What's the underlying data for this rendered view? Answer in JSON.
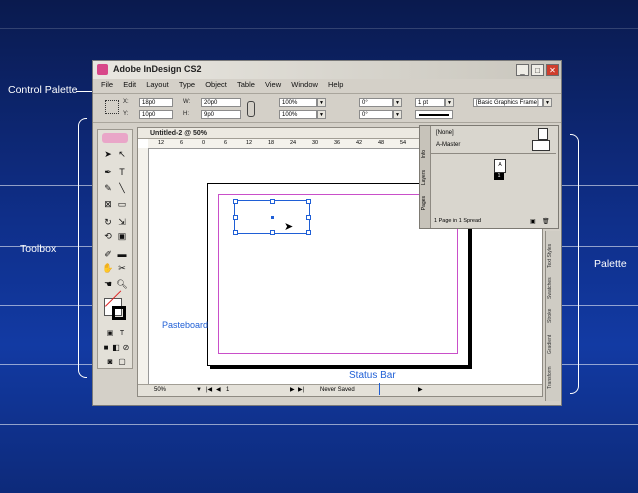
{
  "window": {
    "title": "Adobe InDesign CS2",
    "controls": {
      "minimize": "_",
      "maximize": "□",
      "close": "✕"
    }
  },
  "menu": [
    "File",
    "Edit",
    "Layout",
    "Type",
    "Object",
    "Table",
    "View",
    "Window",
    "Help"
  ],
  "control_palette": {
    "x_label": "X:",
    "x_value": "18p0",
    "y_label": "Y:",
    "y_value": "10p0",
    "w_label": "W:",
    "w_value": "20p0",
    "h_label": "H:",
    "h_value": "9p0",
    "scale_x": "100%",
    "scale_y": "100%",
    "rotate": "0°",
    "shear": "0°",
    "stroke_weight": "1 pt",
    "object_style": "[Basic Graphics Frame]"
  },
  "document": {
    "tab_title": "Untitled-2 @ 50%",
    "ruler_ticks": [
      "12",
      "6",
      "0",
      "6",
      "12",
      "18",
      "24",
      "30",
      "36",
      "42",
      "48",
      "54"
    ],
    "pasteboard_label": "Pasteboard"
  },
  "status_bar": {
    "zoom": "50%",
    "page": "1",
    "save_status": "Never Saved"
  },
  "pages_palette": {
    "tabs": [
      "Pages",
      "Layers",
      "Info"
    ],
    "none_label": "[None]",
    "master_label": "A-Master",
    "page_number": "1",
    "footer": "1 Page in 1 Spread"
  },
  "side_palette_tabs": [
    "Text Styles",
    "Swatches",
    "Stroke",
    "Gradient",
    "Transform"
  ],
  "callouts": {
    "control_palette": "Control Palette",
    "toolbox": "Toolbox",
    "palette": "Palette",
    "status_bar": "Status Bar"
  },
  "colors": {
    "background": "#0f2f8a",
    "accent": "#d8488a",
    "frame": "#1f5fd6"
  }
}
